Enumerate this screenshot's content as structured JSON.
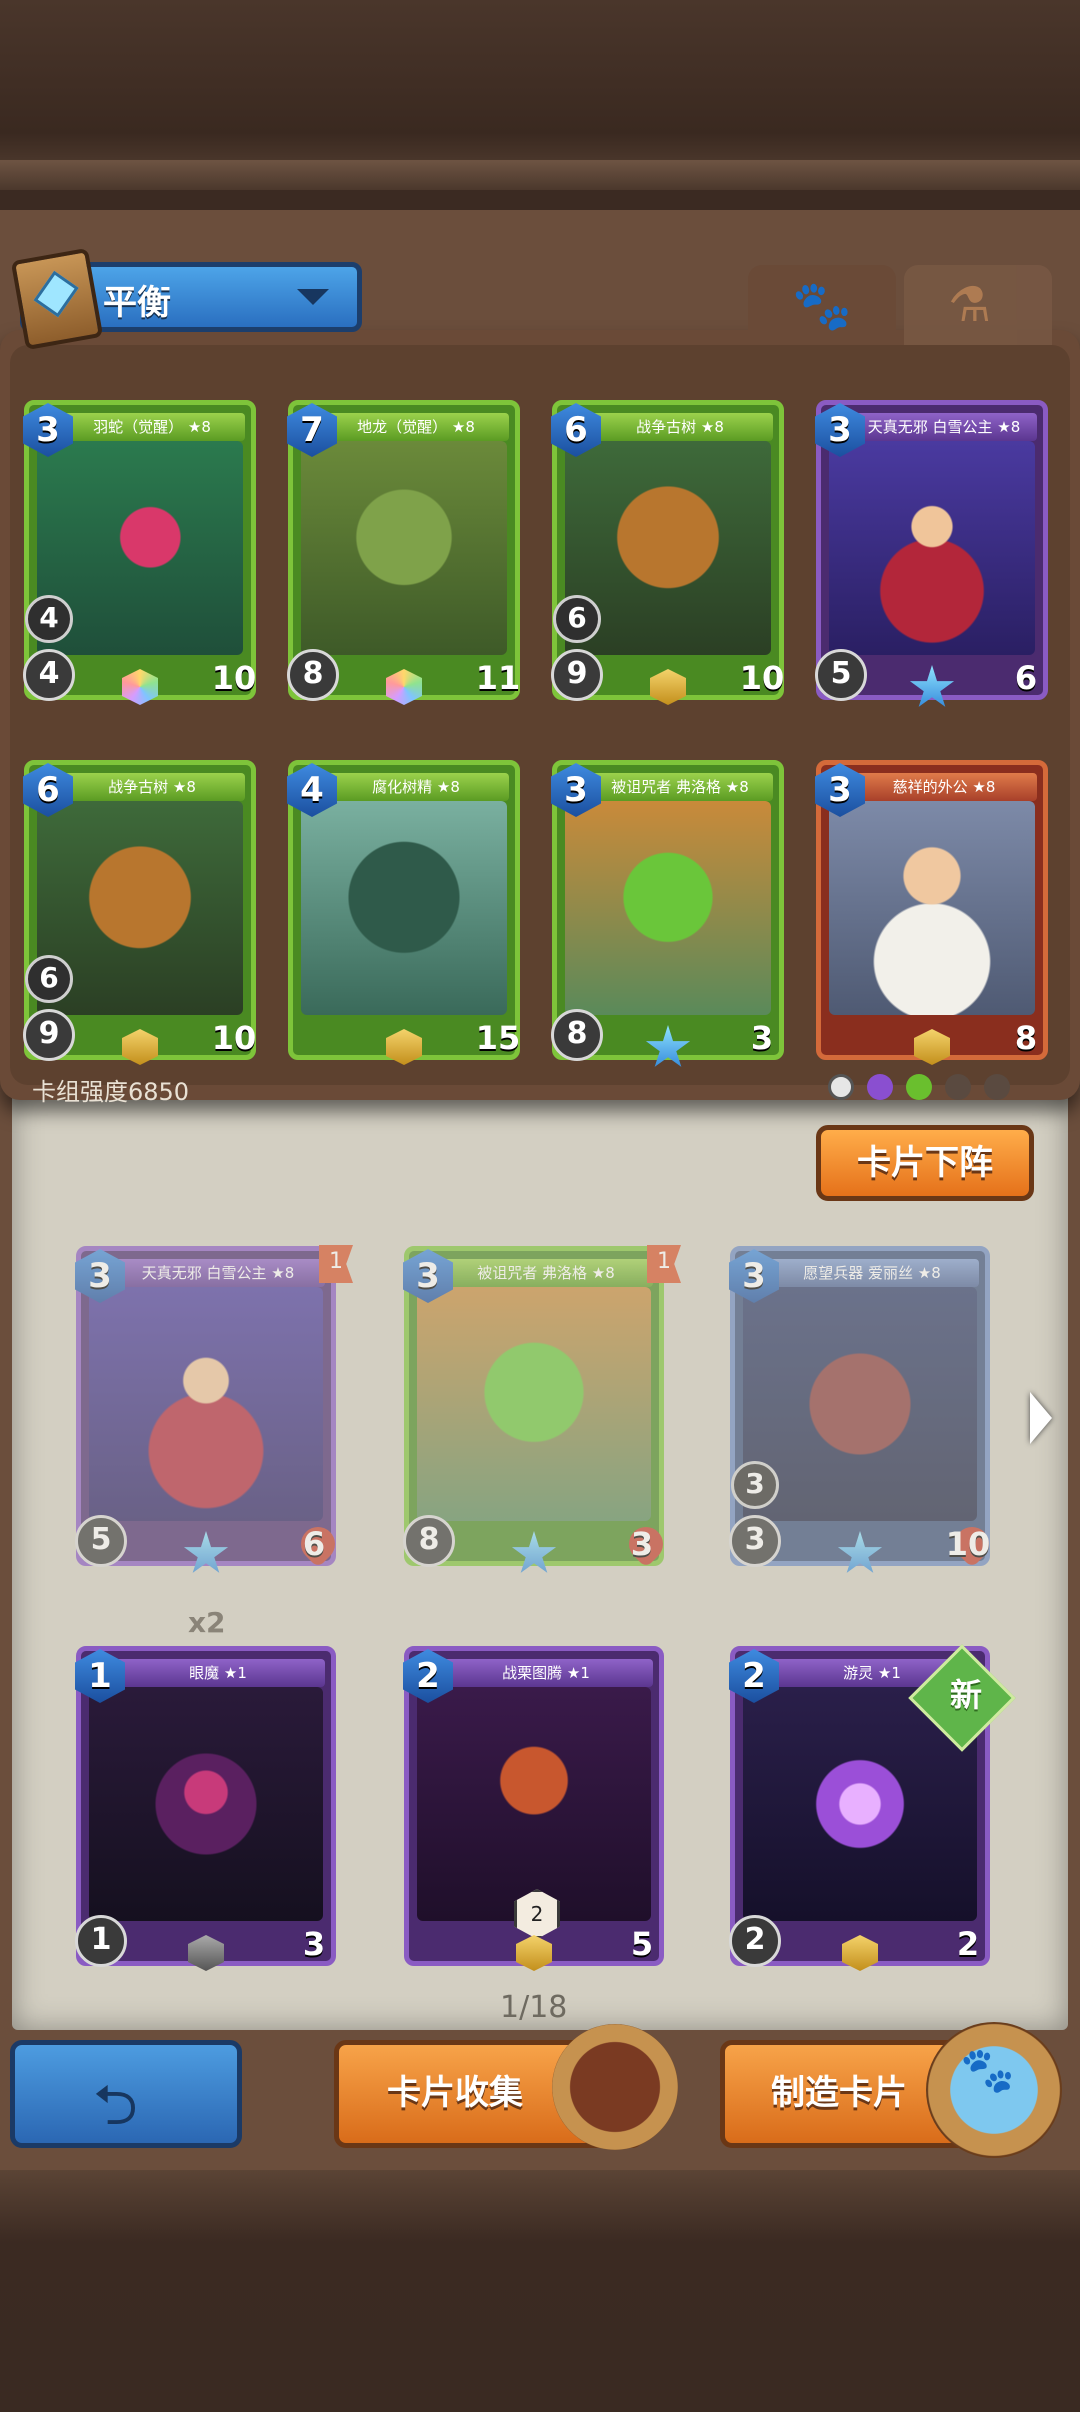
{
  "deck_selector": {
    "label": "平衡"
  },
  "tabs": [
    {
      "icon": "paw-icon"
    },
    {
      "icon": "potion-icon"
    }
  ],
  "deck": {
    "strength_label": "卡组强度6850",
    "cards": [
      {
        "name": "羽蛇（觉醒） ★8",
        "cost": "3",
        "range": "4",
        "attack": "4",
        "hp": "10",
        "sub1": "",
        "sub2": "2"
      },
      {
        "name": "地龙（觉醒） ★8",
        "cost": "7",
        "range": "",
        "attack": "8",
        "hp": "11",
        "sub1": "1",
        "sub2": "2"
      },
      {
        "name": "战争古树 ★8",
        "cost": "6",
        "range": "6",
        "attack": "9",
        "hp": "10",
        "sub1": "1",
        "sub2": ""
      },
      {
        "name": "天真无邪 白雪公主 ★8",
        "cost": "3",
        "range": "",
        "attack": "5",
        "hp": "6",
        "sub1": "2",
        "sub2": "1"
      },
      {
        "name": "战争古树 ★8",
        "cost": "6",
        "range": "6",
        "attack": "9",
        "hp": "10",
        "sub1": "1",
        "sub2": ""
      },
      {
        "name": "腐化树精 ★8",
        "cost": "4",
        "range": "",
        "attack": "",
        "hp": "15",
        "sub1": "4",
        "sub2": "3"
      },
      {
        "name": "被诅咒者 弗洛格 ★8",
        "cost": "3",
        "range": "",
        "attack": "8",
        "hp": "3",
        "sub1": "2",
        "sub2": ""
      },
      {
        "name": "慈祥的外公 ★8",
        "cost": "3",
        "range": "",
        "attack": "",
        "hp": "8",
        "sub1": "4",
        "sub2": "1"
      }
    ]
  },
  "unload_button": "卡片下阵",
  "collection": {
    "cards": [
      {
        "name": "天真无邪 白雪公主 ★8",
        "cost": "3",
        "attack": "5",
        "hp": "6",
        "ribbon": "1",
        "sub": "2"
      },
      {
        "name": "被诅咒者 弗洛格 ★8",
        "cost": "3",
        "attack": "8",
        "hp": "3",
        "ribbon": "1",
        "sub": "2"
      },
      {
        "name": "愿望兵器 爱丽丝 ★8",
        "cost": "3",
        "attack": "3",
        "hp": "10",
        "range": "3",
        "sub": "2"
      },
      {
        "name": "眼魔 ★1",
        "cost": "1",
        "attack": "1",
        "hp": "3",
        "copies": "x2"
      },
      {
        "name": "战栗图腾 ★1",
        "cost": "2",
        "attack": "",
        "hp": "5",
        "sub": "2"
      },
      {
        "name": "游灵 ★1",
        "cost": "2",
        "attack": "2",
        "hp": "2",
        "badge": "新"
      }
    ],
    "page": "1/18"
  },
  "bottom_bar": {
    "collect_label": "卡片收集",
    "craft_label": "制造卡片"
  }
}
